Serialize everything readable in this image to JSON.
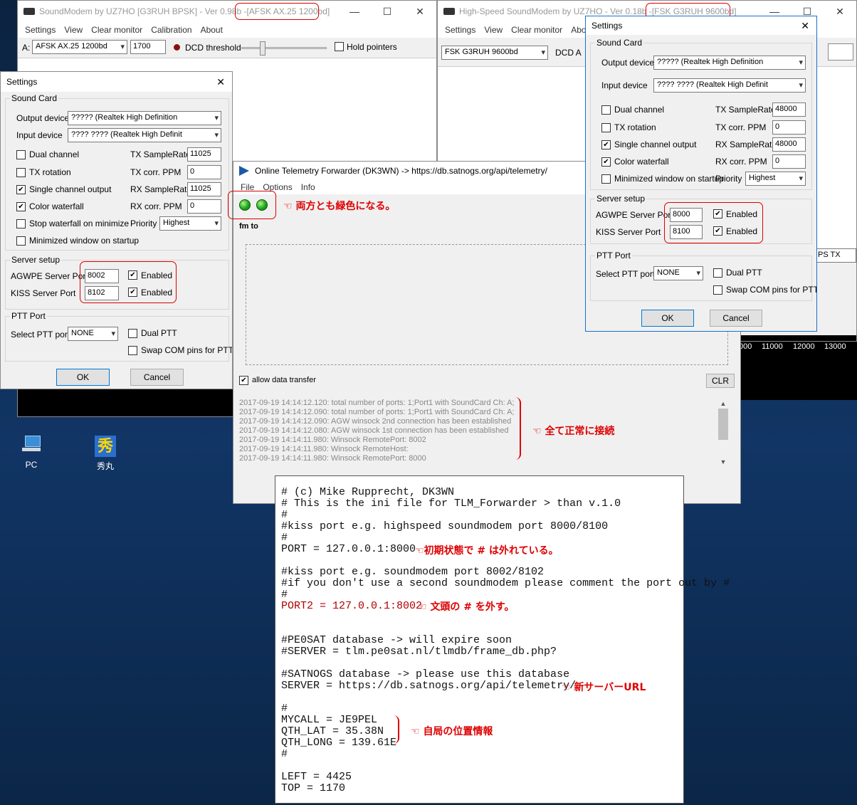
{
  "soundmodem": {
    "title": "SoundModem by UZ7HO [G3RUH BPSK] - Ver 0.98b - [AFSK AX.25 1200bd]",
    "title_prefix": "SoundModem by UZ7HO [G3RUH BPSK] - Ver 0.98b - ",
    "title_mode": "[AFSK AX.25 1200bd]",
    "menu": [
      "Settings",
      "View",
      "Clear monitor",
      "Calibration",
      "About"
    ],
    "channel_label": "A:",
    "mode_value": "AFSK AX.25 1200bd",
    "freq_value": "1700",
    "dcd_label": "DCD threshold",
    "hold_label": "Hold pointers"
  },
  "hs_soundmodem": {
    "title_prefix": "High-Speed SoundModem by UZ7HO - Ver 0.18b - ",
    "title_mode": "[FSK G3RUH 9600bd]",
    "menu": [
      "Settings",
      "View",
      "Clear monitor",
      "Abo"
    ],
    "mode_value": "FSK G3RUH 9600bd",
    "dcd_label": "DCD A",
    "waterfall_ticks": [
      "000",
      "11000",
      "12000",
      "13000"
    ],
    "ps_tx": "PS TX"
  },
  "settings_left": {
    "title": "Settings",
    "sound_card_label": "Sound Card",
    "output_label": "Output device",
    "output_value": "????? (Realtek High Definition",
    "input_label": "Input device",
    "input_value": "???? ???? (Realtek High Definit",
    "dual_channel": "Dual channel",
    "tx_rotation": "TX rotation",
    "single_channel": "Single channel output",
    "color_waterfall": "Color waterfall",
    "stop_waterfall": "Stop waterfall on minimize",
    "minimized_startup": "Minimized window on startup",
    "tx_samplerate_label": "TX SampleRate",
    "tx_samplerate": "11025",
    "tx_ppm_label": "TX corr. PPM",
    "tx_ppm": "0",
    "rx_samplerate_label": "RX SampleRate",
    "rx_samplerate": "11025",
    "rx_ppm_label": "RX corr. PPM",
    "rx_ppm": "0",
    "priority_label": "Priority",
    "priority_value": "Highest",
    "server_label": "Server setup",
    "agwpe_label": "AGWPE Server Port",
    "agwpe_port": "8002",
    "kiss_label": "KISS Server Port",
    "kiss_port": "8102",
    "enabled": "Enabled",
    "ptt_label": "PTT Port",
    "select_ptt_label": "Select PTT port",
    "ptt_value": "NONE",
    "dual_ptt": "Dual PTT",
    "swap_com": "Swap COM pins for PTT",
    "ok": "OK",
    "cancel": "Cancel"
  },
  "settings_right": {
    "title": "Settings",
    "sound_card_label": "Sound Card",
    "output_label": "Output device",
    "output_value": "????? (Realtek High Definition",
    "input_label": "Input device",
    "input_value": "???? ???? (Realtek High Definit",
    "dual_channel": "Dual channel",
    "tx_rotation": "TX rotation",
    "single_channel": "Single channel output",
    "color_waterfall": "Color waterfall",
    "minimized_startup": "Minimized window on startup",
    "tx_samplerate_label": "TX SampleRate",
    "tx_samplerate": "48000",
    "tx_ppm_label": "TX corr. PPM",
    "tx_ppm": "0",
    "rx_samplerate_label": "RX SampleRate",
    "rx_samplerate": "48000",
    "rx_ppm_label": "RX corr. PPM",
    "rx_ppm": "0",
    "priority_label": "Priority",
    "priority_value": "Highest",
    "server_label": "Server setup",
    "agwpe_label": "AGWPE Server Port",
    "agwpe_port": "8000",
    "kiss_label": "KISS Server Port",
    "kiss_port": "8100",
    "enabled": "Enabled",
    "ptt_label": "PTT Port",
    "select_ptt_label": "Select PTT port",
    "ptt_value": "NONE",
    "dual_ptt": "Dual PTT",
    "swap_com": "Swap COM pins for PTT",
    "ok": "OK",
    "cancel": "Cancel"
  },
  "forwarder": {
    "title": "Online Telemetry Forwarder (DK3WN) -> https://db.satnogs.org/api/telemetry/",
    "menu": [
      "File",
      "Options",
      "Info"
    ],
    "fm_to": "fm to",
    "allow_transfer": "allow data transfer",
    "clr": "CLR",
    "log": [
      "2017-09-19 14:14:12.120: total number of ports: 1;Port1 with SoundCard Ch: A;",
      "2017-09-19 14:14:12.090: total number of ports: 1;Port1 with SoundCard Ch: A;",
      "2017-09-19 14:14:12.090: AGW winsock 2nd connection has been established",
      "2017-09-19 14:14:12.080: AGW winsock 1st connection has been established",
      "2017-09-19 14:14:11.980: Winsock RemotePort: 8002",
      "2017-09-19 14:14:11.980: Winsock RemoteHost:",
      "2017-09-19 14:14:11.980: Winsock RemotePort: 8000"
    ]
  },
  "annotations": {
    "both_green": "両方とも緑色になる。",
    "all_connected": "全て正常に接続",
    "initially_uncommented": "初期状態で # は外れている。",
    "remove_hash": "文頭の # を外す。",
    "new_server": "新サーバーURL",
    "location": "自局の位置情報"
  },
  "ini": {
    "lines": [
      "# (c) Mike Rupprecht, DK3WN",
      "# This is the ini file for TLM_Forwarder > than v.1.0",
      "#",
      "#kiss port e.g. highspeed soundmodem port 8000/8100",
      "#",
      "PORT = 127.0.0.1:8000",
      "",
      "#kiss port e.g. soundmodem port 8002/8102",
      "#if you don't use a second soundmodem please comment the port out by #",
      "#",
      "PORT2 = 127.0.0.1:8002",
      "",
      "",
      "#PE0SAT database -> will expire soon",
      "#SERVER = tlm.pe0sat.nl/tlmdb/frame_db.php?",
      "",
      "#SATNOGS database -> please use this database",
      "SERVER = https://db.satnogs.org/api/telemetry/",
      "",
      "#",
      "MYCALL = JE9PEL",
      "QTH_LAT = 35.38N",
      "QTH_LONG = 139.61E",
      "#",
      "",
      "LEFT = 4425",
      "TOP = 1170"
    ]
  },
  "desktop": {
    "pc_label": "PC",
    "hidemaru_label": "秀丸"
  },
  "colors": {
    "annotation_red": "#dd0000",
    "led_green": "#1ea81e",
    "desktop_blue": "#0d2a4d"
  }
}
